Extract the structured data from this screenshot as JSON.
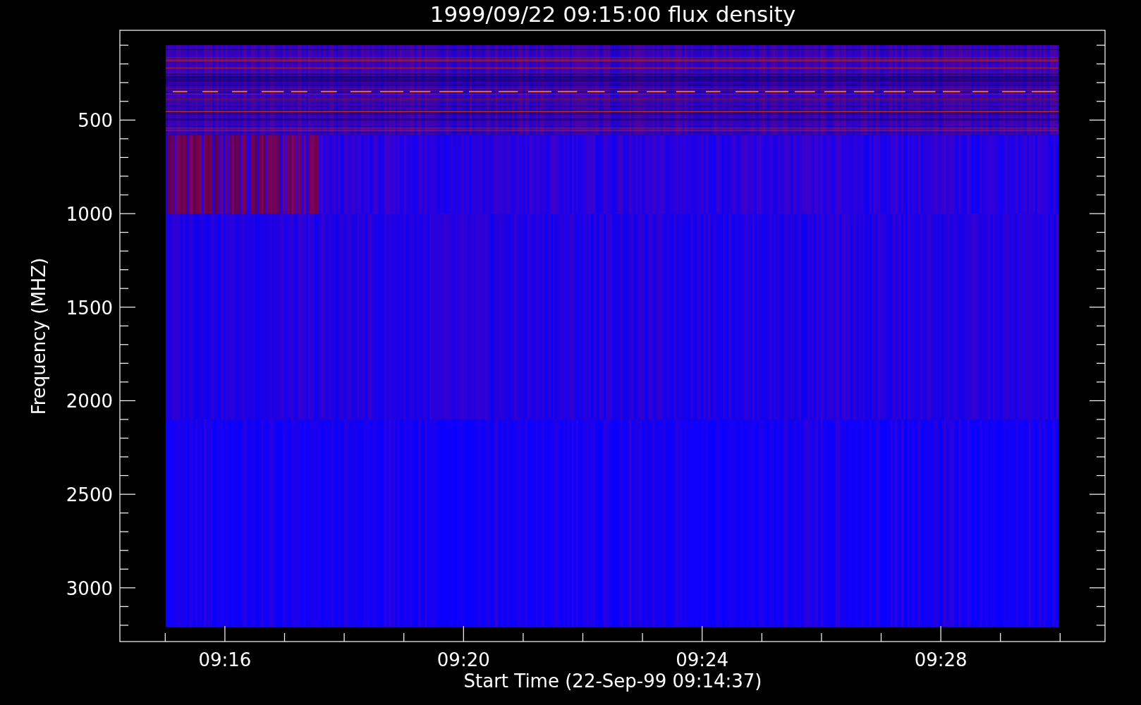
{
  "title": "1999/09/22 09:15:00 flux density",
  "ylabel": "Frequency (MHZ)",
  "xlabel": "Start Time (22-Sep-99 09:14:37)",
  "yticks": [
    "500",
    "1000",
    "1500",
    "2000",
    "2500",
    "3000"
  ],
  "xticks": [
    "09:16",
    "09:20",
    "09:24",
    "09:28"
  ]
}
